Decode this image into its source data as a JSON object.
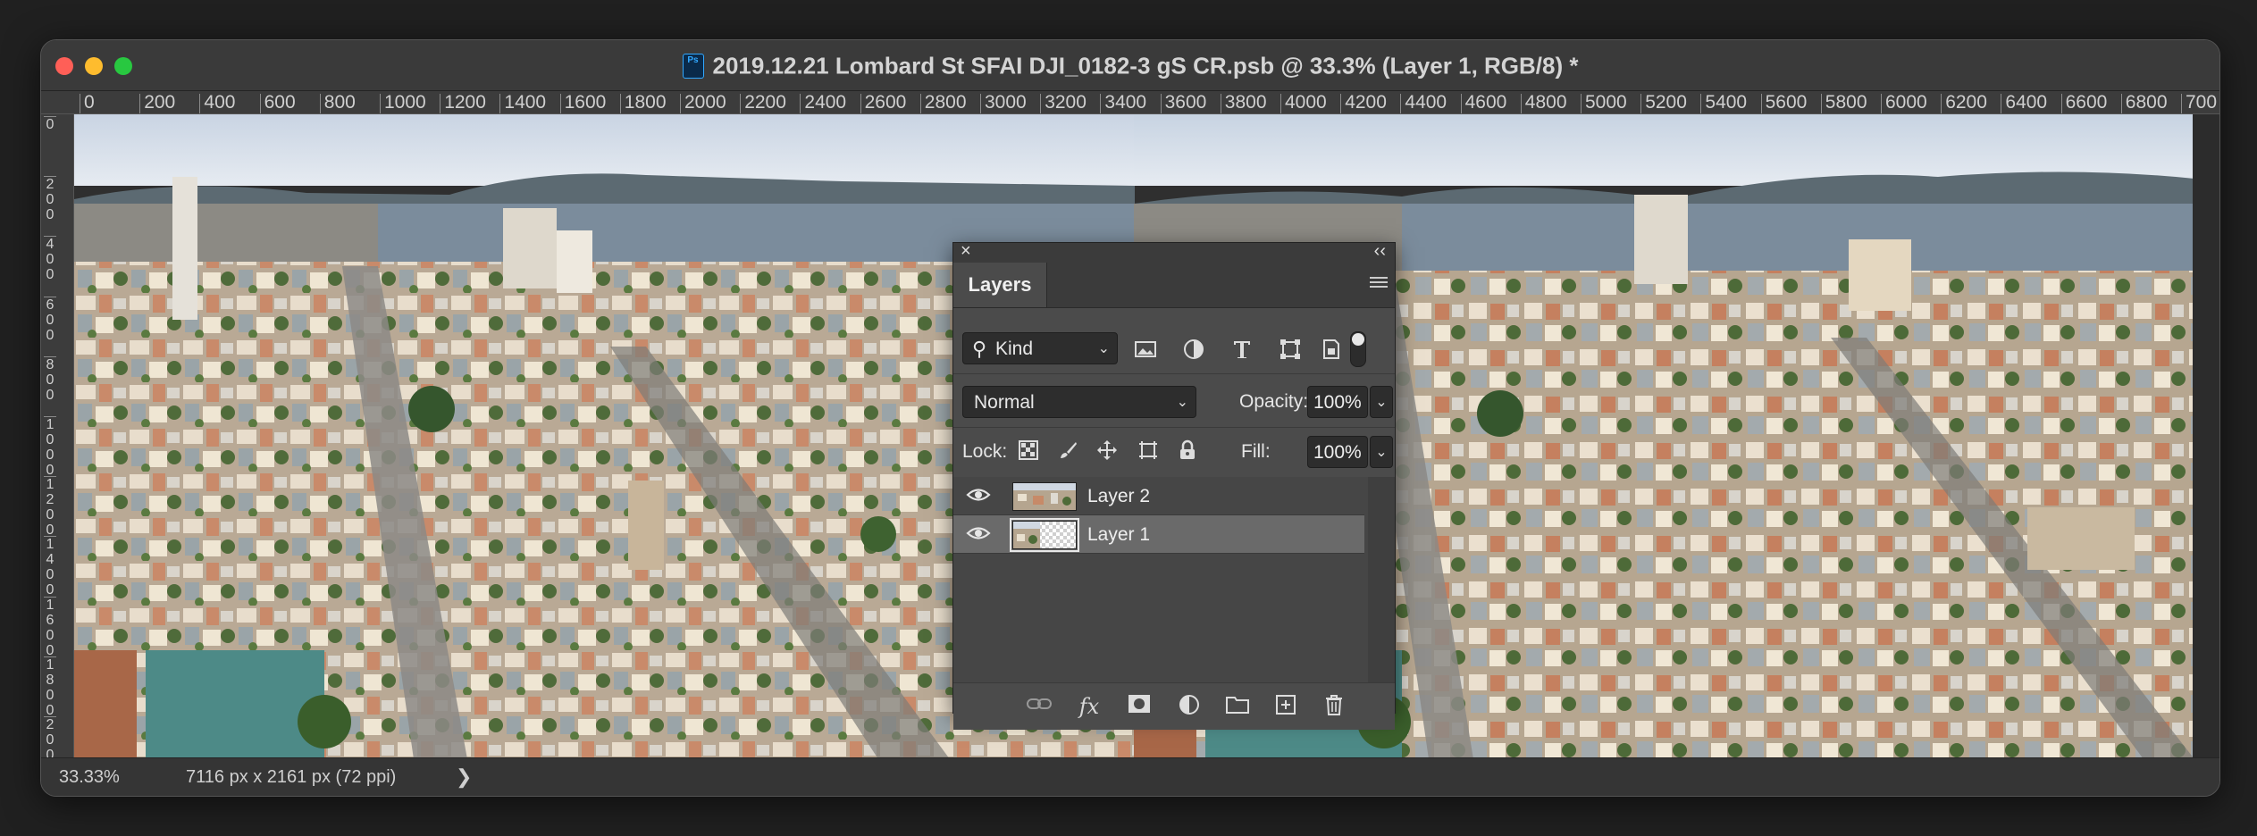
{
  "window": {
    "title": "2019.12.21 Lombard St SFAI DJI_0182-3 gS CR.psb @ 33.3% (Layer 1, RGB/8) *",
    "app_icon_label": "Ps"
  },
  "ruler": {
    "horizontal": [
      "0",
      "200",
      "400",
      "600",
      "800",
      "1000",
      "1200",
      "1400",
      "1600",
      "1800",
      "2000",
      "2200",
      "2400",
      "2600",
      "2800",
      "3000",
      "3200",
      "3400",
      "3600",
      "3800",
      "4000",
      "4200",
      "4400",
      "4600",
      "4800",
      "5000",
      "5200",
      "5400",
      "5600",
      "5800",
      "6000",
      "6200",
      "6400",
      "6600",
      "6800",
      "700"
    ],
    "vertical": [
      "0",
      "200",
      "400",
      "600",
      "800",
      "1000",
      "1200",
      "1400",
      "1600",
      "1800",
      "2000"
    ]
  },
  "status": {
    "zoom": "33.33%",
    "doc_info": "7116 px x 2161 px (72 ppi)",
    "chevron": "❯"
  },
  "layers_panel": {
    "tab_label": "Layers",
    "close_glyph": "×",
    "collapse_glyph": "‹‹",
    "filter": {
      "kind_label": "Kind",
      "icons": [
        "image-filter-icon",
        "adjustment-filter-icon",
        "type-filter-icon",
        "shape-filter-icon",
        "smart-object-filter-icon"
      ]
    },
    "blend_mode": "Normal",
    "opacity_label": "Opacity:",
    "opacity_value": "100%",
    "lock_label": "Lock:",
    "fill_label": "Fill:",
    "fill_value": "100%",
    "layers": [
      {
        "name": "Layer 2",
        "visible": true,
        "selected": false
      },
      {
        "name": "Layer 1",
        "visible": true,
        "selected": true
      }
    ],
    "footer_icons": [
      "link-layers-icon",
      "fx-icon",
      "add-mask-icon",
      "adjustment-layer-icon",
      "new-group-icon",
      "new-layer-icon",
      "trash-icon"
    ],
    "fx_label": "fx"
  }
}
